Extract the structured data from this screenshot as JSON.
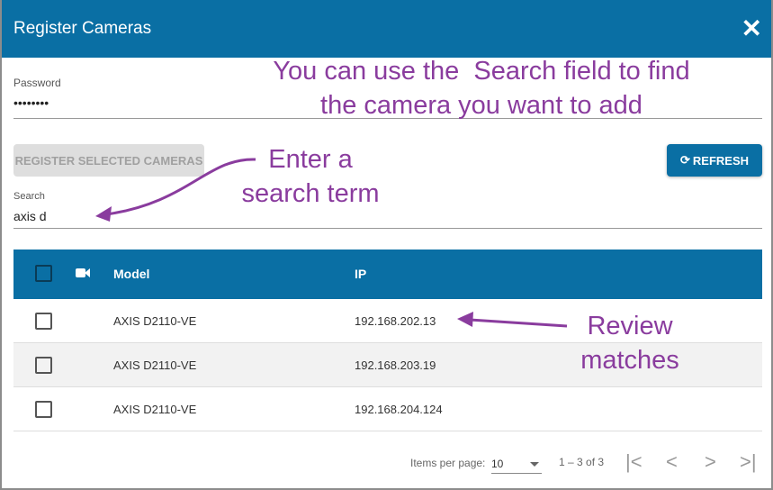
{
  "dialog": {
    "title": "Register Cameras",
    "close_icon": "close-icon"
  },
  "password": {
    "label": "Password",
    "value": "••••••••"
  },
  "buttons": {
    "register": "REGISTER SELECTED CAMERAS",
    "refresh": "REFRESH"
  },
  "search": {
    "label": "Search",
    "value": "axis d"
  },
  "table": {
    "headers": {
      "model": "Model",
      "ip": "IP"
    },
    "rows": [
      {
        "model": "AXIS D2110-VE",
        "ip": "192.168.202.13"
      },
      {
        "model": "AXIS D2110-VE",
        "ip": "192.168.203.19"
      },
      {
        "model": "AXIS D2110-VE",
        "ip": "192.168.204.124"
      }
    ]
  },
  "paginator": {
    "items_per_page_label": "Items per page:",
    "items_per_page": "10",
    "range": "1 – 3 of 3"
  },
  "annotations": {
    "search_field_line1": "You can use the  Search field to find",
    "search_field_line2": "the camera you want to add",
    "enter_line1": "Enter a",
    "enter_line2": "search term",
    "review_line1": "Review",
    "review_line2": "matches"
  },
  "colors": {
    "primary": "#0a6fa4",
    "annotation": "#8a3c9e"
  }
}
